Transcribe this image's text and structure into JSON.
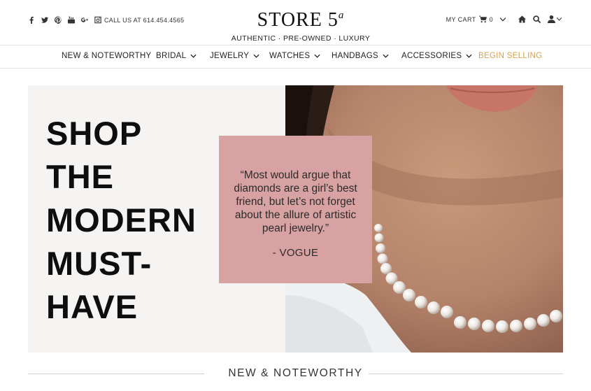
{
  "header": {
    "social_icons": [
      "facebook-icon",
      "twitter-icon",
      "pinterest-icon",
      "youtube-icon",
      "google-plus-icon",
      "instagram-icon"
    ],
    "call_text": "CALL US AT 614.454.4565",
    "logo_text": "STORE 5",
    "logo_sup": "a",
    "tagline": "AUTHENTIC · PRE-OWNED · LUXURY",
    "cart_label": "MY CART",
    "cart_count": "0"
  },
  "nav": {
    "items": [
      {
        "label": "NEW & NOTEWORTHY"
      },
      {
        "label": "BRIDAL"
      },
      {
        "label": "JEWELRY"
      },
      {
        "label": "WATCHES"
      },
      {
        "label": "HANDBAGS"
      },
      {
        "label": "ACCESSORIES"
      },
      {
        "label": "BEGIN SELLING"
      }
    ]
  },
  "hero": {
    "headline": [
      "SHOP",
      "THE",
      "MODERN",
      "MUST-",
      "HAVE"
    ],
    "quote": "“Most would argue that diamonds are a girl’s best friend, but let’s not forget about the allure of artistic pearl jewelry.”",
    "quote_source": "- VOGUE"
  },
  "section": {
    "title": "NEW & NOTEWORTHY"
  },
  "colors": {
    "accent": "#d9a24e",
    "quote_bg": "#d9a2a2",
    "hero_bg": "#f5f4f2"
  }
}
